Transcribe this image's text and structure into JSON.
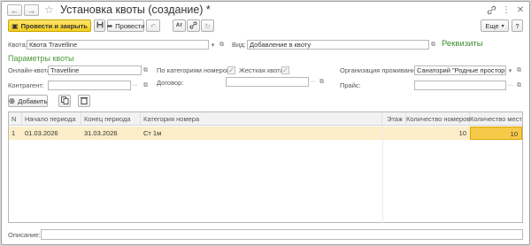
{
  "window": {
    "title": "Установка квоты (создание) *",
    "nav": {
      "back": "←",
      "forward": "→"
    }
  },
  "toolbar": {
    "post_close_label": "Провести и закрыть",
    "post_label": "Провести",
    "more_label": "Еще",
    "help_label": "?"
  },
  "form": {
    "quota_label": "Квота:",
    "quota_value": "Квота Travelline",
    "kind_label": "Вид:",
    "kind_value": "Добавление в квоту",
    "requisites_link": "Реквизиты",
    "section_title": "Параметры квоты",
    "online_quota_label": "Онлайн-квота:",
    "online_quota_value": "Travelline",
    "by_room_categories_label": "По категориям номеров:",
    "hard_quota_label": "Жесткая квота:",
    "organization_label": "Организация проживания:",
    "organization_value": "Санаторий \"Родные просторы\"",
    "counterparty_label": "Контрагент:",
    "counterparty_value": "",
    "contract_label": "Договор:",
    "contract_value": "",
    "price_label": "Прайс:",
    "price_value": "",
    "add_label": "Добавить",
    "description_label": "Описание:",
    "description_value": ""
  },
  "table": {
    "columns": [
      "N",
      "Начало периода",
      "Конец периода",
      "Категория номера",
      "Этаж",
      "Количество номеров",
      "Количество мест"
    ],
    "rows": [
      {
        "n": "1",
        "start": "01.03.2026",
        "end": "31.03.2026",
        "category": "Ст 1м",
        "floor": "",
        "rooms": "10",
        "places": "10"
      }
    ]
  }
}
